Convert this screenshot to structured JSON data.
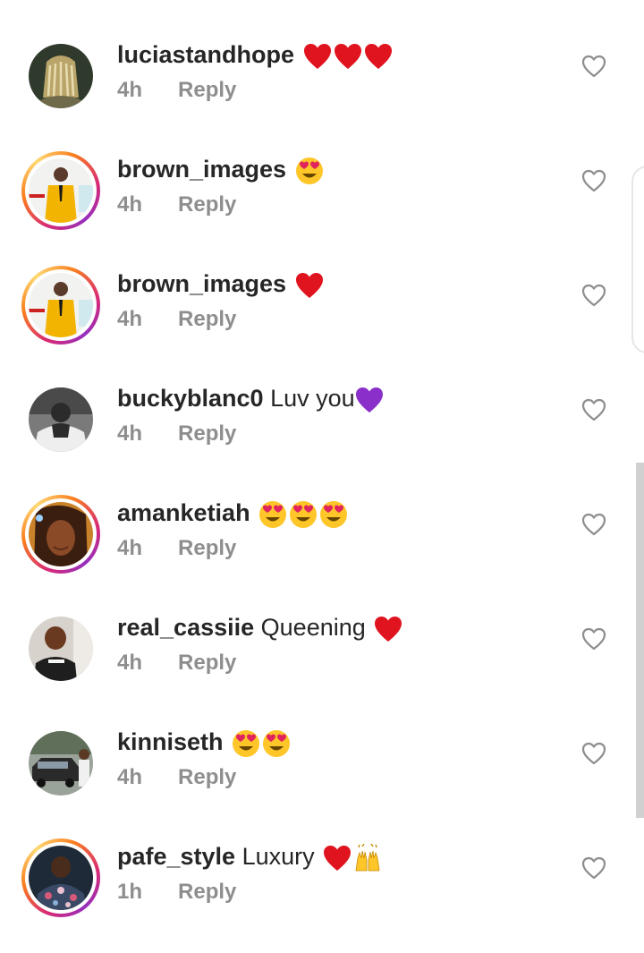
{
  "comments": [
    {
      "username": "luciastandhope",
      "text": "",
      "emojis": [
        "red-heart",
        "red-heart",
        "red-heart"
      ],
      "time": "4h",
      "reply": "Reply",
      "avatar": "gold-braids-avatar",
      "story_ring": false
    },
    {
      "username": "brown_images",
      "text": "",
      "emojis": [
        "heart-eyes"
      ],
      "time": "4h",
      "reply": "Reply",
      "avatar": "yellow-suit-avatar",
      "story_ring": true
    },
    {
      "username": "brown_images",
      "text": "",
      "emojis": [
        "red-heart"
      ],
      "time": "4h",
      "reply": "Reply",
      "avatar": "yellow-suit-avatar",
      "story_ring": true
    },
    {
      "username": "buckyblanc0",
      "text": "Luv you",
      "emojis": [
        "purple-heart"
      ],
      "time": "4h",
      "reply": "Reply",
      "avatar": "white-fur-avatar",
      "story_ring": false
    },
    {
      "username": "amanketiah",
      "text": "",
      "emojis": [
        "heart-eyes",
        "heart-eyes",
        "heart-eyes"
      ],
      "time": "4h",
      "reply": "Reply",
      "avatar": "selfie-avatar",
      "story_ring": true
    },
    {
      "username": "real_cassiie",
      "text": "Queening",
      "emojis": [
        "red-heart"
      ],
      "time": "4h",
      "reply": "Reply",
      "avatar": "mirror-selfie-avatar",
      "story_ring": false
    },
    {
      "username": "kinniseth",
      "text": "",
      "emojis": [
        "heart-eyes",
        "heart-eyes"
      ],
      "time": "4h",
      "reply": "Reply",
      "avatar": "car-avatar",
      "story_ring": false
    },
    {
      "username": "pafe_style",
      "text": "Luxury",
      "emojis": [
        "red-heart",
        "raised-hands"
      ],
      "time": "1h",
      "reply": "Reply",
      "avatar": "floral-suit-avatar",
      "story_ring": true
    }
  ],
  "colors": {
    "username": "#262626",
    "meta": "#8e8e8e",
    "heart_red": "#e0141f",
    "purple_heart": "#8a2fc9",
    "like_outline": "#8e8e8e"
  },
  "icons": {
    "like": "heart-outline-icon"
  }
}
